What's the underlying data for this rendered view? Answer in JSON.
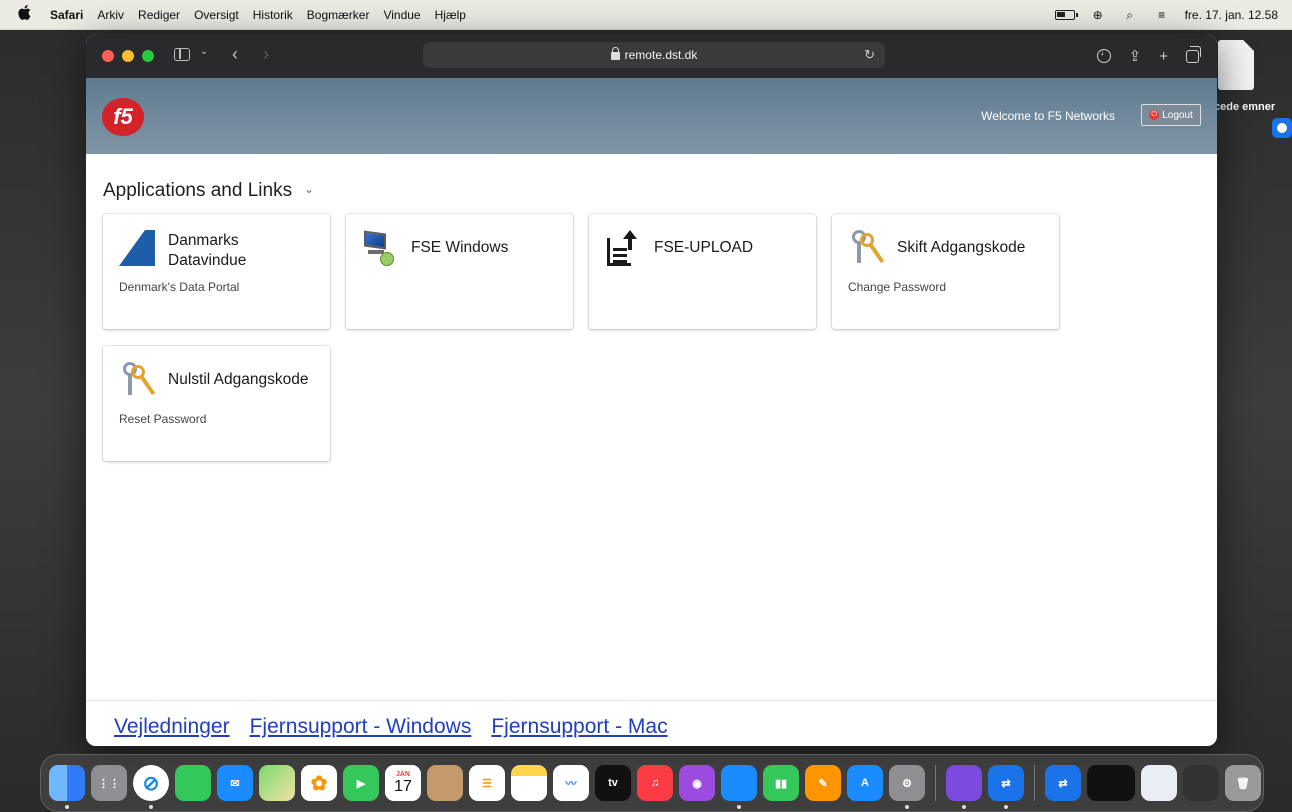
{
  "menubar": {
    "app": "Safari",
    "items": [
      "Arkiv",
      "Rediger",
      "Oversigt",
      "Historik",
      "Bogmærker",
      "Vindue",
      "Hjælp"
    ],
    "clock": "fre. 17. jan. 12.58"
  },
  "desktop": {
    "file_label": "cede emner"
  },
  "browser": {
    "url": "remote.dst.dk"
  },
  "f5": {
    "logo_text": "f5",
    "welcome": "Welcome to F5 Networks",
    "logout_label": "Logout"
  },
  "apps_section": {
    "title": "Applications and Links",
    "cards": [
      {
        "title_line1": "Danmarks",
        "title_line2": "Datavindue",
        "subtitle": "Denmark's Data Portal",
        "icon": "dst-logo-icon"
      },
      {
        "title": "FSE Windows",
        "subtitle": "",
        "icon": "remote-desktop-icon"
      },
      {
        "title": "FSE-UPLOAD",
        "subtitle": "",
        "icon": "upload-icon"
      },
      {
        "title": "Skift Adgangskode",
        "subtitle": "Change Password",
        "icon": "keys-icon"
      },
      {
        "title": "Nulstil Adgangskode",
        "subtitle": "Reset Password",
        "icon": "keys-icon"
      }
    ]
  },
  "footer": {
    "links": [
      "Vejledninger",
      "Fjernsupport - Windows",
      "Fjernsupport - Mac"
    ]
  },
  "dock": {
    "calendar_month": "JAN",
    "calendar_day": "17",
    "tv_label": "tv",
    "apps": [
      "finder",
      "launchpad",
      "safari",
      "messages",
      "mail",
      "maps",
      "photos",
      "facetime",
      "calendar",
      "contacts",
      "reminders",
      "notes",
      "freeform",
      "tv",
      "music",
      "podcasts",
      "keynote",
      "numbers",
      "pages",
      "app-store",
      "system-settings",
      "simulator",
      "teamviewer",
      "teamviewer-2",
      "window",
      "preview",
      "screenshot",
      "trash"
    ]
  },
  "colors": {
    "f5_red": "#d2232a",
    "link_blue": "#1f3fbf",
    "header_slate": "#6e879a"
  }
}
